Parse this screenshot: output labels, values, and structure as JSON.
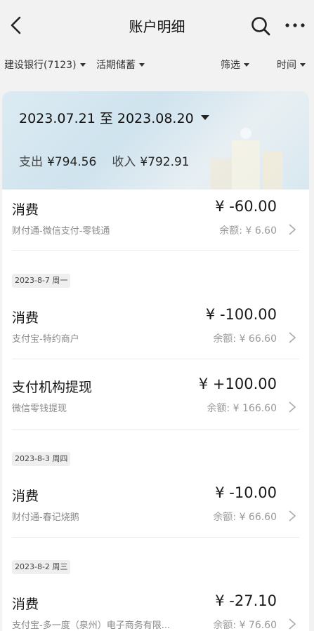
{
  "header": {
    "title": "账户明细"
  },
  "filters": {
    "account": "建设银行(7123)",
    "type": "活期储蓄",
    "filter": "筛选",
    "time": "时间"
  },
  "summary": {
    "date_range": "2023.07.21 至 2023.08.20",
    "expense_label": "支出",
    "expense_value": "¥794.56",
    "income_label": "收入",
    "income_value": "¥792.91"
  },
  "balance_label": "余额:",
  "groups": [
    {
      "date": "",
      "items": [
        {
          "name": "消费",
          "amount": "¥ -60.00",
          "desc": "财付通-微信支付-零钱通",
          "balance": "¥ 6.60"
        }
      ]
    },
    {
      "date": "2023-8-7 周一",
      "items": [
        {
          "name": "消费",
          "amount": "¥ -100.00",
          "desc": "支付宝-特约商户",
          "balance": "¥ 66.60"
        },
        {
          "name": "支付机构提现",
          "amount": "¥ +100.00",
          "desc": "微信零钱提现",
          "balance": "¥ 166.60"
        }
      ]
    },
    {
      "date": "2023-8-3 周四",
      "items": [
        {
          "name": "消费",
          "amount": "¥ -10.00",
          "desc": "财付通-春记烧鹅",
          "balance": "¥ 66.60"
        }
      ]
    },
    {
      "date": "2023-8-2 周三",
      "items": [
        {
          "name": "消费",
          "amount": "¥ -27.10",
          "desc": "支付宝-多一度（泉州）电子商务有限...",
          "balance": "¥ 76.60"
        }
      ]
    }
  ]
}
